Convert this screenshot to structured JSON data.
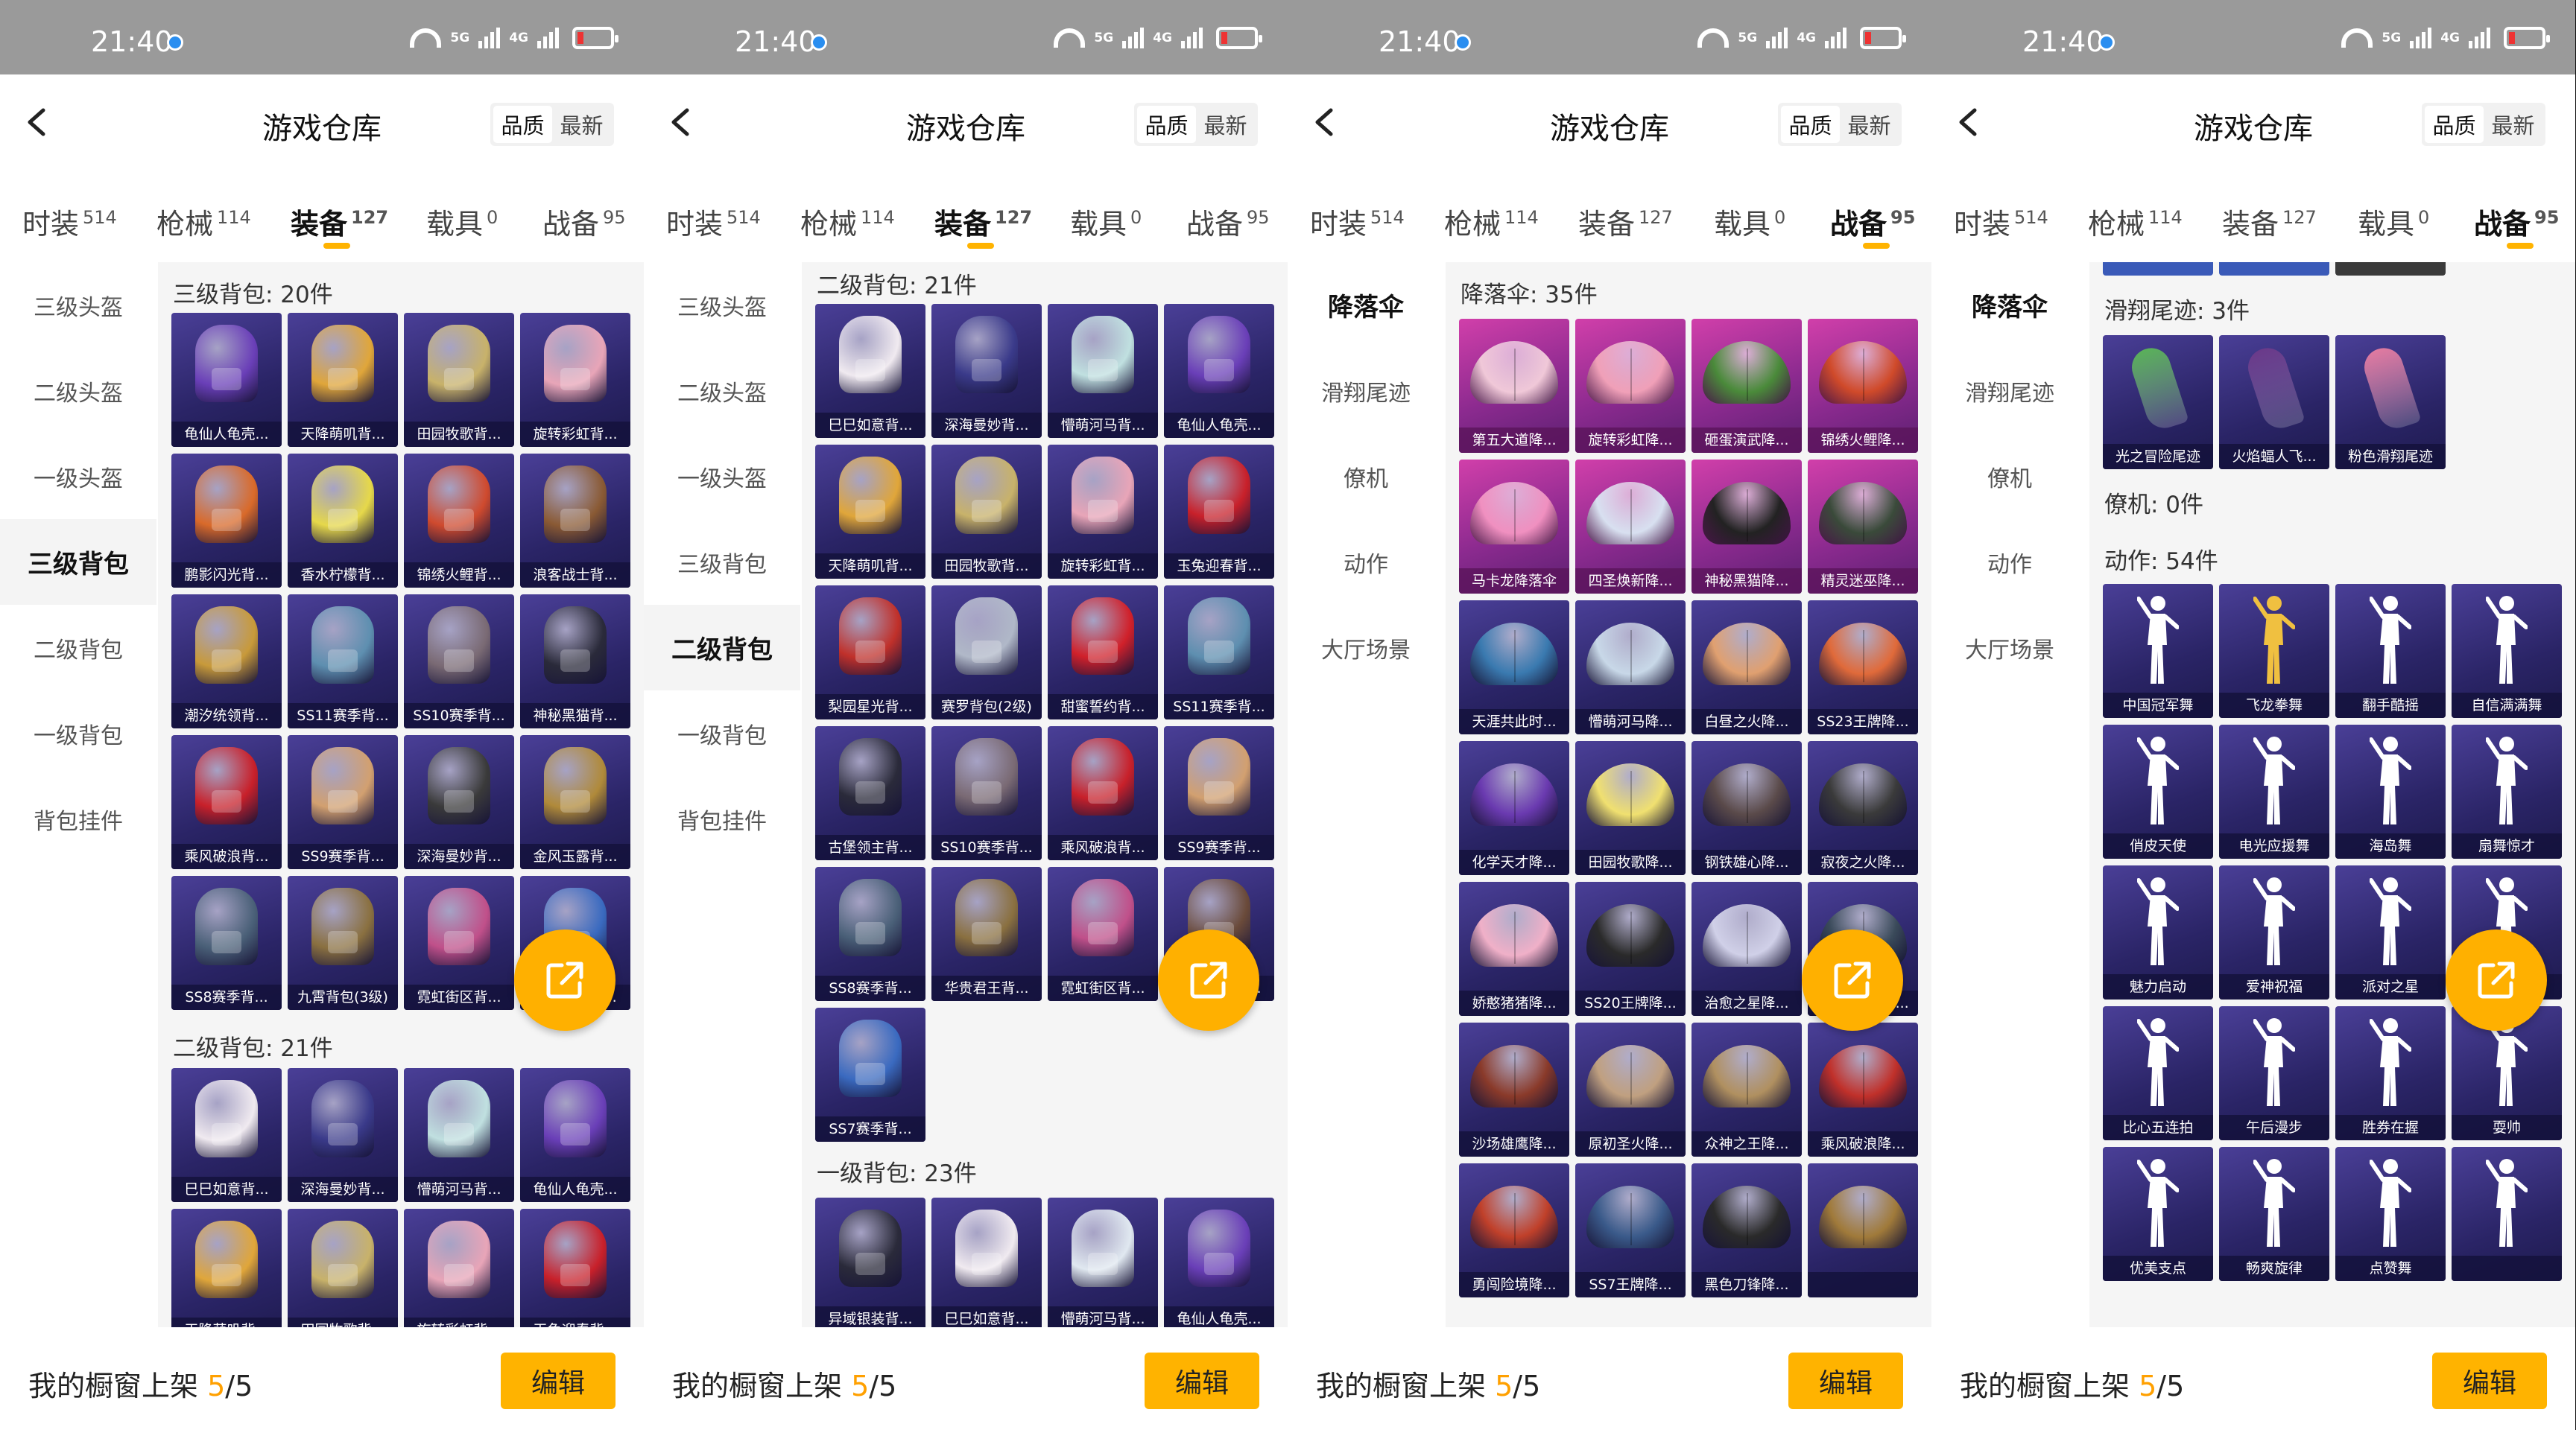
{
  "status": {
    "time": "21:40",
    "sig1": "5G",
    "sig2": "4G"
  },
  "header": {
    "title": "游戏仓库",
    "sort_quality": "品质",
    "sort_latest": "最新"
  },
  "tabs": [
    {
      "label": "时装",
      "count": "514"
    },
    {
      "label": "枪械",
      "count": "114"
    },
    {
      "label": "装备",
      "count": "127"
    },
    {
      "label": "载具",
      "count": "0"
    },
    {
      "label": "战备",
      "count": "95"
    }
  ],
  "equip_menu": [
    "三级头盔",
    "二级头盔",
    "一级头盔",
    "三级背包",
    "二级背包",
    "一级背包",
    "背包挂件"
  ],
  "prep_menu": [
    "降落伞",
    "滑翔尾迹",
    "僚机",
    "动作",
    "大厅场景"
  ],
  "footer": {
    "prefix": "我的橱窗上架 ",
    "current": "5",
    "suffix": "/5",
    "edit_label": "编辑"
  },
  "accent_color": "#ffb300",
  "panels": [
    {
      "active_tab": "装备",
      "active_menu": "三级背包",
      "sections": [
        {
          "label": "三级背包: 20件",
          "items": [
            {
              "name": "龟仙人龟壳...",
              "color": "#6a3fb8",
              "kind": "backpack"
            },
            {
              "name": "天降萌叽背...",
              "color": "#e0a63a",
              "kind": "backpack"
            },
            {
              "name": "田园牧歌背...",
              "color": "#c8b26a",
              "kind": "backpack"
            },
            {
              "name": "旋转彩虹背...",
              "color": "#e8a5b8",
              "kind": "backpack"
            },
            {
              "name": "鹏影闪光背...",
              "color": "#d96a2a",
              "kind": "backpack"
            },
            {
              "name": "香水柠檬背...",
              "color": "#e6d84a",
              "kind": "backpack"
            },
            {
              "name": "锦绣火鲤背...",
              "color": "#cf4a2e",
              "kind": "backpack"
            },
            {
              "name": "浪客战士背...",
              "color": "#8a5a34",
              "kind": "backpack"
            },
            {
              "name": "潮汐统领背...",
              "color": "#c89a3a",
              "kind": "backpack"
            },
            {
              "name": "SS11赛季背...",
              "color": "#5e8fb0",
              "kind": "backpack"
            },
            {
              "name": "SS10赛季背...",
              "color": "#7a6a74",
              "kind": "backpack"
            },
            {
              "name": "神秘黑猫背...",
              "color": "#2a2a3a",
              "kind": "backpack"
            },
            {
              "name": "乘风破浪背...",
              "color": "#c8202a",
              "kind": "backpack"
            },
            {
              "name": "SS9赛季背...",
              "color": "#d2a070",
              "kind": "backpack"
            },
            {
              "name": "深海曼妙背...",
              "color": "#3a3a3a",
              "kind": "backpack"
            },
            {
              "name": "金风玉露背...",
              "color": "#b08a3a",
              "kind": "backpack"
            },
            {
              "name": "SS8赛季背...",
              "color": "#4a6078",
              "kind": "backpack"
            },
            {
              "name": "九霄背包(3级)",
              "color": "#8a7040",
              "kind": "backpack"
            },
            {
              "name": "霓虹街区背...",
              "color": "#c0508a",
              "kind": "backpack"
            },
            {
              "name": "SS7赛季背...",
              "color": "#3a6ac0",
              "kind": "backpack"
            }
          ]
        },
        {
          "label": "二级背包: 21件",
          "items": [
            {
              "name": "巳巳如意背...",
              "color": "#f0eaf0",
              "kind": "backpack"
            },
            {
              "name": "深海曼妙背...",
              "color": "#3a3a8a",
              "kind": "backpack"
            },
            {
              "name": "懵萌河马背...",
              "color": "#c0e0e0",
              "kind": "backpack"
            },
            {
              "name": "龟仙人龟壳...",
              "color": "#6a3fb8",
              "kind": "backpack"
            },
            {
              "name": "天降萌叽背...",
              "color": "#e0a63a",
              "kind": "backpack"
            },
            {
              "name": "田园牧歌背...",
              "color": "#c8b26a",
              "kind": "backpack"
            },
            {
              "name": "旋转彩虹背...",
              "color": "#e8a5b8",
              "kind": "backpack"
            },
            {
              "name": "玉兔迎春背...",
              "color": "#c8202a",
              "kind": "backpack"
            }
          ]
        }
      ]
    },
    {
      "active_tab": "装备",
      "active_menu": "二级背包",
      "sections": [
        {
          "label": "二级背包: 21件",
          "items": [
            {
              "name": "巳巳如意背...",
              "color": "#f0eaf0",
              "kind": "backpack"
            },
            {
              "name": "深海曼妙背...",
              "color": "#3a3a8a",
              "kind": "backpack"
            },
            {
              "name": "懵萌河马背...",
              "color": "#c0e0e0",
              "kind": "backpack"
            },
            {
              "name": "龟仙人龟壳...",
              "color": "#6a3fb8",
              "kind": "backpack"
            },
            {
              "name": "天降萌叽背...",
              "color": "#e0a63a",
              "kind": "backpack"
            },
            {
              "name": "田园牧歌背...",
              "color": "#c8b26a",
              "kind": "backpack"
            },
            {
              "name": "旋转彩虹背...",
              "color": "#e8a5b8",
              "kind": "backpack"
            },
            {
              "name": "玉兔迎春背...",
              "color": "#c8202a",
              "kind": "backpack"
            },
            {
              "name": "梨园星光背...",
              "color": "#c0302a",
              "kind": "backpack"
            },
            {
              "name": "赛罗背包(2级)",
              "color": "#b0b8c8",
              "kind": "backpack"
            },
            {
              "name": "甜蜜誓约背...",
              "color": "#d0202a",
              "kind": "backpack"
            },
            {
              "name": "SS11赛季背...",
              "color": "#5e8fb0",
              "kind": "backpack"
            },
            {
              "name": "古堡领主背...",
              "color": "#2a2a3a",
              "kind": "backpack"
            },
            {
              "name": "SS10赛季背...",
              "color": "#7a6a74",
              "kind": "backpack"
            },
            {
              "name": "乘风破浪背...",
              "color": "#c8202a",
              "kind": "backpack"
            },
            {
              "name": "SS9赛季背...",
              "color": "#d2a070",
              "kind": "backpack"
            },
            {
              "name": "SS8赛季背...",
              "color": "#4a6078",
              "kind": "backpack"
            },
            {
              "name": "华贵君王背...",
              "color": "#8a7040",
              "kind": "backpack"
            },
            {
              "name": "霓虹街区背...",
              "color": "#c0508a",
              "kind": "backpack"
            },
            {
              "name": "精灵迷巫背...",
              "color": "#6a4a3a",
              "kind": "backpack"
            },
            {
              "name": "SS7赛季背...",
              "color": "#3a6ac0",
              "kind": "backpack"
            }
          ]
        },
        {
          "label": "一级背包: 23件",
          "items": [
            {
              "name": "异域银装背...",
              "color": "#2a2a3a",
              "kind": "backpack"
            },
            {
              "name": "巳巳如意背...",
              "color": "#f0eaf0",
              "kind": "backpack"
            },
            {
              "name": "懵萌河马背...",
              "color": "#e0e8f0",
              "kind": "backpack"
            },
            {
              "name": "龟仙人龟壳...",
              "color": "#6a3fb8",
              "kind": "backpack"
            }
          ]
        }
      ]
    },
    {
      "active_tab": "战备",
      "active_menu": "降落伞",
      "sections": [
        {
          "label": "降落伞: 35件",
          "items": [
            {
              "name": "第五大道降...",
              "color": "#f0c8d8",
              "kind": "para",
              "pink": true
            },
            {
              "name": "旋转彩虹降...",
              "color": "#f0a0b8",
              "kind": "para",
              "pink": true
            },
            {
              "name": "砸蛋演武降...",
              "color": "#4a8a3a",
              "kind": "para",
              "pink": true
            },
            {
              "name": "锦绣火鲤降...",
              "color": "#d04a2a",
              "kind": "para",
              "pink": true
            },
            {
              "name": "马卡龙降落伞",
              "color": "#f090c0",
              "kind": "para",
              "pink": true
            },
            {
              "name": "四圣焕新降...",
              "color": "#d8e0f0",
              "kind": "para",
              "pink": true
            },
            {
              "name": "神秘黑猫降...",
              "color": "#222222",
              "kind": "para",
              "pink": true
            },
            {
              "name": "精灵迷巫降...",
              "color": "#3a4a3a",
              "kind": "para",
              "pink": true
            },
            {
              "name": "天涯共此时...",
              "color": "#3a7ab0",
              "kind": "para"
            },
            {
              "name": "懵萌河马降...",
              "color": "#c8d8e8",
              "kind": "para"
            },
            {
              "name": "白昼之火降...",
              "color": "#e0a070",
              "kind": "para"
            },
            {
              "name": "SS23王牌降...",
              "color": "#e06a3a",
              "kind": "para"
            },
            {
              "name": "化学天才降...",
              "color": "#6a3ab0",
              "kind": "para"
            },
            {
              "name": "田园牧歌降...",
              "color": "#f0e070",
              "kind": "para"
            },
            {
              "name": "钢铁雄心降...",
              "color": "#5a4a4a",
              "kind": "para"
            },
            {
              "name": "寂夜之火降...",
              "color": "#3a3a3a",
              "kind": "para"
            },
            {
              "name": "娇憨猪猪降...",
              "color": "#f0b0c8",
              "kind": "para"
            },
            {
              "name": "SS20王牌降...",
              "color": "#2a2a2a",
              "kind": "para"
            },
            {
              "name": "治愈之星降...",
              "color": "#d0d0e8",
              "kind": "para"
            },
            {
              "name": "SS14王牌降...",
              "color": "#3a4a5a",
              "kind": "para"
            },
            {
              "name": "沙场雄鹰降...",
              "color": "#8a3a2a",
              "kind": "para"
            },
            {
              "name": "原初圣火降...",
              "color": "#c0a080",
              "kind": "para"
            },
            {
              "name": "众神之王降...",
              "color": "#b09060",
              "kind": "para"
            },
            {
              "name": "乘风破浪降...",
              "color": "#c0302a",
              "kind": "para"
            },
            {
              "name": "勇闯险境降...",
              "color": "#c0402a",
              "kind": "para"
            },
            {
              "name": "SS7王牌降...",
              "color": "#3a5a8a",
              "kind": "para"
            },
            {
              "name": "黑色刀锋降...",
              "color": "#2a2a2a",
              "kind": "para"
            },
            {
              "name": "",
              "color": "#a07a3a",
              "kind": "para"
            }
          ]
        }
      ]
    },
    {
      "active_tab": "战备",
      "active_menu": "降落伞",
      "sections": [
        {
          "label": "滑翔尾迹: 3件",
          "items": [
            {
              "name": "光之冒险尾迹",
              "color": "#5ab05a",
              "kind": "trail"
            },
            {
              "name": "火焰蝠人飞...",
              "color": "#6a3a8a",
              "kind": "trail"
            },
            {
              "name": "粉色滑翔尾迹",
              "color": "#e07aa0",
              "kind": "trail"
            }
          ]
        },
        {
          "label": "僚机: 0件",
          "items": []
        },
        {
          "label": "动作: 54件",
          "items": [
            {
              "name": "中国冠军舞",
              "color": "#ffffff",
              "kind": "dance"
            },
            {
              "name": "飞龙拳舞",
              "color": "#f0c040",
              "kind": "dance"
            },
            {
              "name": "翻手酷摇",
              "color": "#ffffff",
              "kind": "dance"
            },
            {
              "name": "自信满满舞",
              "color": "#ffffff",
              "kind": "dance"
            },
            {
              "name": "俏皮天使",
              "color": "#ffffff",
              "kind": "dance"
            },
            {
              "name": "电光应援舞",
              "color": "#ffffff",
              "kind": "dance"
            },
            {
              "name": "海岛舞",
              "color": "#ffffff",
              "kind": "dance"
            },
            {
              "name": "扇舞惊才",
              "color": "#ffffff",
              "kind": "dance"
            },
            {
              "name": "魅力启动",
              "color": "#ffffff",
              "kind": "dance"
            },
            {
              "name": "爱神祝福",
              "color": "#ffffff",
              "kind": "dance"
            },
            {
              "name": "派对之星",
              "color": "#ffffff",
              "kind": "dance"
            },
            {
              "name": "招牌小可怜",
              "color": "#ffffff",
              "kind": "dance"
            },
            {
              "name": "比心五连拍",
              "color": "#ffffff",
              "kind": "dance"
            },
            {
              "name": "午后漫步",
              "color": "#ffffff",
              "kind": "dance"
            },
            {
              "name": "胜券在握",
              "color": "#ffffff",
              "kind": "dance"
            },
            {
              "name": "耍帅",
              "color": "#ffffff",
              "kind": "dance"
            },
            {
              "name": "优美支点",
              "color": "#ffffff",
              "kind": "dance"
            },
            {
              "name": "畅爽旋律",
              "color": "#ffffff",
              "kind": "dance"
            },
            {
              "name": "点赞舞",
              "color": "#ffffff",
              "kind": "dance"
            },
            {
              "name": "",
              "color": "#ffffff",
              "kind": "dance"
            }
          ]
        }
      ]
    }
  ]
}
